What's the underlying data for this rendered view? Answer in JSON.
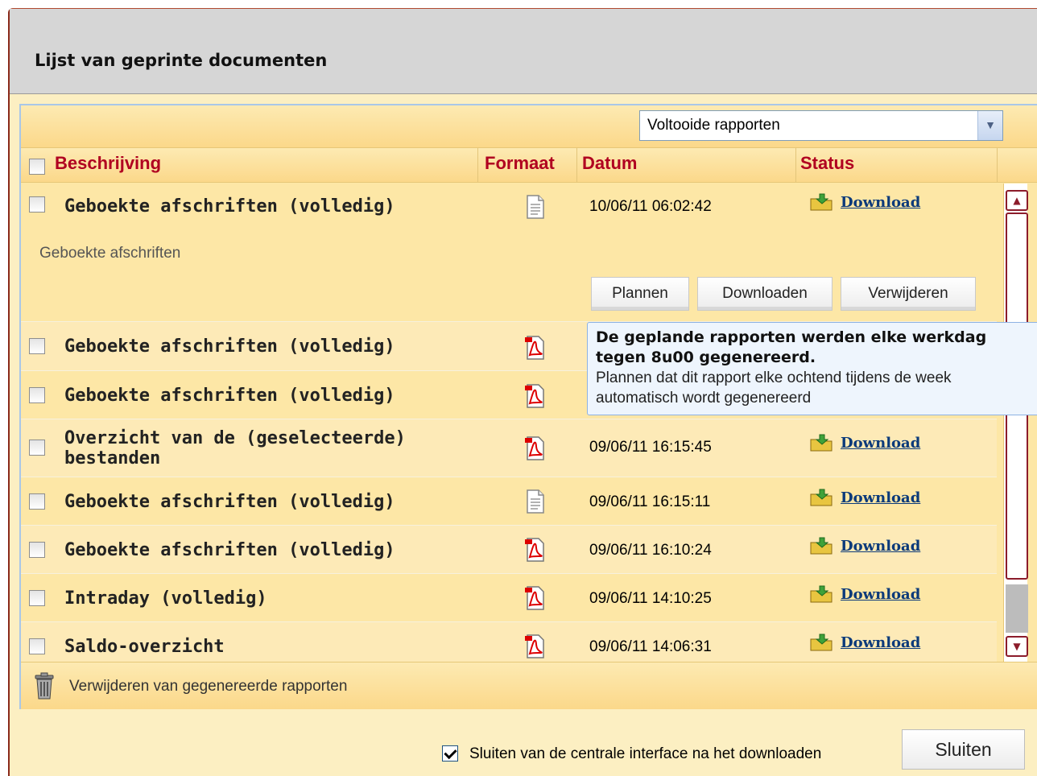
{
  "window": {
    "title": "Lijst van geprinte documenten"
  },
  "filter": {
    "selected": "Voltooide rapporten"
  },
  "table": {
    "headers": {
      "description": "Beschrijving",
      "format": "Formaat",
      "date": "Datum",
      "status": "Status"
    },
    "expanded": {
      "description": "Geboekte afschriften (volledig)",
      "format_icon": "text-file-icon",
      "date": "10/06/11 06:02:42",
      "status": "Download",
      "detail": "Geboekte afschriften",
      "buttons": {
        "plan": "Plannen",
        "download": "Downloaden",
        "delete": "Verwijderen"
      }
    },
    "rows": [
      {
        "description": "Geboekte afschriften (volledig)",
        "format_icon": "pdf-icon",
        "date": "",
        "status": ""
      },
      {
        "description": "Geboekte afschriften (volledig)",
        "format_icon": "pdf-icon",
        "date": "",
        "status": ""
      },
      {
        "description": "Overzicht van de (geselecteerde) bestanden",
        "format_icon": "pdf-icon",
        "date": "09/06/11 16:15:45",
        "status": "Download"
      },
      {
        "description": "Geboekte afschriften (volledig)",
        "format_icon": "text-file-icon",
        "date": "09/06/11 16:15:11",
        "status": "Download"
      },
      {
        "description": "Geboekte afschriften (volledig)",
        "format_icon": "pdf-icon",
        "date": "09/06/11 16:10:24",
        "status": "Download"
      },
      {
        "description": "Intraday (volledig)",
        "format_icon": "pdf-icon",
        "date": "09/06/11 14:10:25",
        "status": "Download"
      },
      {
        "description": "Saldo-overzicht",
        "format_icon": "pdf-icon",
        "date": "09/06/11 14:06:31",
        "status": "Download"
      }
    ]
  },
  "tooltip": {
    "title": "De geplande rapporten werden elke werkdag tegen 8u00 gegenereerd.",
    "body": "Plannen dat dit rapport elke ochtend tijdens de week automatisch wordt gegenereerd"
  },
  "footer": {
    "delete_generated": "Verwijderen van gegenereerde rapporten",
    "close_after_download": "Sluiten van de centrale interface na het downloaden",
    "close_after_download_checked": true,
    "close_button": "Sluiten"
  },
  "colors": {
    "header_text": "#b00020",
    "link": "#0b3a7a",
    "row_bg": "#fde7a6",
    "tooltip_bg": "#eef5fd"
  }
}
